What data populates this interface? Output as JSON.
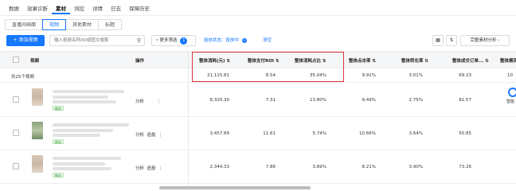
{
  "top_tabs": [
    "数据",
    "效果诊断",
    "素材",
    "词控",
    "详情",
    "日志",
    "保障历史"
  ],
  "active_top_tab": "素材",
  "sub_tabs": [
    "直播间画面",
    "视频",
    "其他素材",
    "标题"
  ],
  "active_sub_tab": "视频",
  "toolbar": {
    "add_video": "+ 添加视频",
    "search_placeholder": "输入视频名称/ID或图文搜索",
    "more_filter": "更多筛选",
    "more_filter_count": "1",
    "status_filter": "投放状态：投放中",
    "clear": "清空",
    "analysis": "完整素材分析 ›"
  },
  "table": {
    "headers": {
      "video": "视频",
      "ops": "操作",
      "cost": "整体消耗(元) ⇅",
      "roi": "整体支付ROI ⇅",
      "cost_ratio": "整体消耗占比 ⇅",
      "ctr": "整体点击率 ⇅",
      "cvr": "整体转化率 ⇅",
      "order_cost": "整体成交订单... ⇅",
      "extra": "整体展现"
    },
    "summary": {
      "label": "共25个视频",
      "cost": "21,115.81",
      "roi": "8.54",
      "cost_ratio": "35.04%",
      "ctr": "9.91%",
      "cvr": "3.01%",
      "order_cost": "69.23",
      "extra": "10"
    },
    "rows": [
      {
        "tag": "精选",
        "ops": [
          "分析",
          "⋮"
        ],
        "cost": "8,320.30",
        "roi": "7.31",
        "cost_ratio": "13.80%",
        "ctr": "9.49%",
        "cvr": "2.75%",
        "order_cost": "81.57"
      },
      {
        "tag": "精选",
        "ops": [
          "分析",
          "追投",
          "⋮"
        ],
        "cost": "3,457.89",
        "roi": "11.61",
        "cost_ratio": "5.74%",
        "ctr": "10.66%",
        "cvr": "3.64%",
        "order_cost": "50.85"
      },
      {
        "tag": "精选",
        "ops": [
          "分析",
          "追投",
          "⋮"
        ],
        "cost": "2,344.33",
        "roi": "7.86",
        "cost_ratio": "3.89%",
        "ctr": "8.21%",
        "cvr": "3.90%",
        "order_cost": "73.26"
      }
    ]
  },
  "side_widget": "智能",
  "colors": {
    "accent": "#1677ff",
    "highlight": "#d9363e"
  }
}
